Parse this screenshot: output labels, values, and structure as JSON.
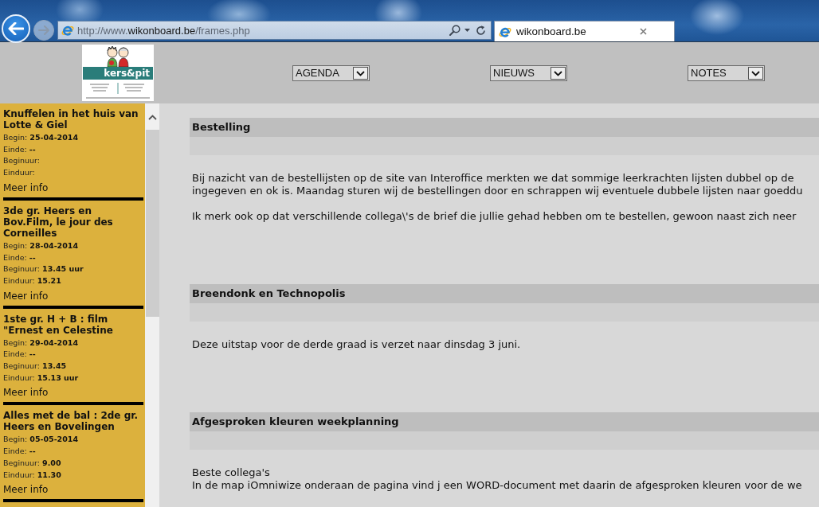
{
  "browser": {
    "url_parts": [
      {
        "text": "http://www.",
        "kind": "dim"
      },
      {
        "text": "wikonboard.be",
        "kind": "host"
      },
      {
        "text": "/frames.php",
        "kind": "dim"
      }
    ],
    "tabs": [
      {
        "label": "wikonboard.be",
        "selected": true
      }
    ]
  },
  "header": {
    "logo": {
      "text": "kers&pit"
    },
    "dropdowns": [
      {
        "value": "AGENDA"
      },
      {
        "value": "NIEUWS"
      },
      {
        "value": "NOTES"
      }
    ]
  },
  "sidebar": {
    "events": [
      {
        "title": "Knuffelen in het huis van Lotte & Giel",
        "details": [
          "Begin: **25-04-2014**",
          "Einde: **--**",
          "Beginuur:",
          "Einduur:"
        ],
        "link": "Meer info"
      },
      {
        "title": "3de gr. Heers en Bov.Film, le jour des Corneilles",
        "details": [
          "Begin: **28-04-2014**",
          "Einde: **--**",
          "Beginuur: **13.45 uur**",
          "Einduur: **15.21**"
        ],
        "link": "Meer info"
      },
      {
        "title": "1ste gr. H + B : film \"Ernest en Celestine",
        "details": [
          "Begin: **29-04-2014**",
          "Einde: **--**",
          "Beginuur: **13.45**",
          "Einduur: **15.13 uur**"
        ],
        "link": "Meer info"
      },
      {
        "title": "Alles met de bal : 2de gr. Heers en Bovelingen",
        "details": [
          "Begin: **05-05-2014**",
          "Einde: **--**",
          "Beginuur: **9.00**",
          "Einduur: **11.30**"
        ],
        "link": "Meer info"
      }
    ]
  },
  "content": {
    "articles": [
      {
        "title": "Bestelling",
        "paragraphs": [
          {
            "lines": [
              "Bij nazicht van de bestellijsten op de site van Interoffice merkten we dat sommige leerkrachten lijsten dubbel op de",
              "ingegeven en ok is. Maandag sturen wij de bestellingen door en schrappen wij eventuele dubbele lijsten naar goeddu"
            ]
          },
          {
            "lines": [
              "Ik merk ook op dat verschillende collega\\'s de brief die jullie gehad hebben om te bestellen, gewoon naast zich neer"
            ]
          }
        ]
      },
      {
        "title": "Breendonk en Technopolis",
        "paragraphs": [
          {
            "lines": [
              "Deze uitstap voor de derde graad is verzet naar dinsdag 3 juni."
            ]
          }
        ]
      },
      {
        "title": "Afgesproken kleuren weekplanning",
        "paragraphs": [
          {
            "lines": [
              "Beste collega's",
              "In de map iOmniwize onderaan de pagina vind j een WORD-document met daarin de afgesproken kleuren voor de we"
            ]
          }
        ]
      }
    ]
  }
}
